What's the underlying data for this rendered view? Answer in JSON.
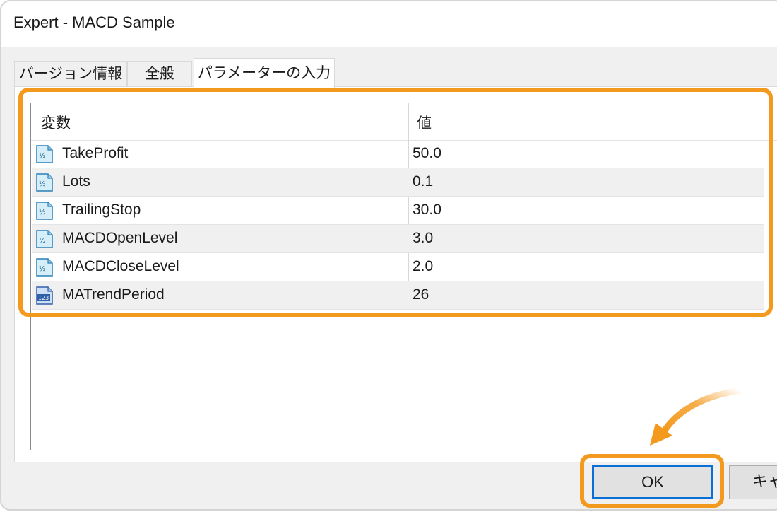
{
  "window": {
    "title": "Expert - MACD Sample"
  },
  "tabs": [
    {
      "label": "バージョン情報",
      "active": false
    },
    {
      "label": "全般",
      "active": false
    },
    {
      "label": "パラメーターの入力",
      "active": true
    }
  ],
  "table": {
    "headers": {
      "variable": "変数",
      "value": "値"
    },
    "rows": [
      {
        "icon": "fraction-variable-icon",
        "name": "TakeProfit",
        "value": "50.0"
      },
      {
        "icon": "fraction-variable-icon",
        "name": "Lots",
        "value": "0.1"
      },
      {
        "icon": "fraction-variable-icon",
        "name": "TrailingStop",
        "value": "30.0"
      },
      {
        "icon": "fraction-variable-icon",
        "name": "MACDOpenLevel",
        "value": "3.0"
      },
      {
        "icon": "fraction-variable-icon",
        "name": "MACDCloseLevel",
        "value": "2.0"
      },
      {
        "icon": "integer-variable-icon",
        "name": "MATrendPeriod",
        "value": "26"
      }
    ]
  },
  "buttons": {
    "ok_label": "OK",
    "cancel_label": "キャ"
  },
  "colors": {
    "highlight": "#f39a1e",
    "focus_border": "#0a6fd6"
  }
}
